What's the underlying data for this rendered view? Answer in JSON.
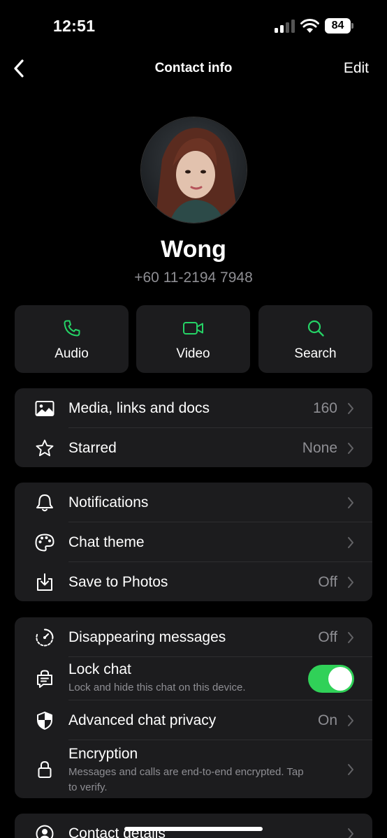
{
  "status_bar": {
    "time": "12:51",
    "battery": "84"
  },
  "nav": {
    "title": "Contact info",
    "edit_label": "Edit"
  },
  "contact": {
    "name": "Wong",
    "phone": "+60 11-2194 7948"
  },
  "actions": [
    {
      "label": "Audio",
      "icon": "phone-icon"
    },
    {
      "label": "Video",
      "icon": "video-icon"
    },
    {
      "label": "Search",
      "icon": "search-icon"
    }
  ],
  "group1": [
    {
      "label": "Media, links and docs",
      "value": "160",
      "icon": "image-icon"
    },
    {
      "label": "Starred",
      "value": "None",
      "icon": "star-icon"
    }
  ],
  "group2": [
    {
      "label": "Notifications",
      "value": "",
      "icon": "bell-icon"
    },
    {
      "label": "Chat theme",
      "value": "",
      "icon": "palette-icon"
    },
    {
      "label": "Save to Photos",
      "value": "Off",
      "icon": "save-icon"
    }
  ],
  "group3": {
    "disappearing": {
      "label": "Disappearing messages",
      "value": "Off"
    },
    "lock_chat": {
      "label": "Lock chat",
      "sub": "Lock and hide this chat on this device.",
      "toggle_on": true
    },
    "advanced_privacy": {
      "label": "Advanced chat privacy",
      "value": "On"
    },
    "encryption": {
      "label": "Encryption",
      "sub_line1": "Messages and calls are end-to-end encrypted. Tap",
      "sub_line2": "to verify."
    }
  },
  "group4": {
    "contact_details": {
      "label": "Contact details"
    }
  },
  "colors": {
    "accent": "#25d366",
    "toggle": "#30d158",
    "card": "#1c1c1e",
    "secondary_text": "#8e8e93"
  }
}
